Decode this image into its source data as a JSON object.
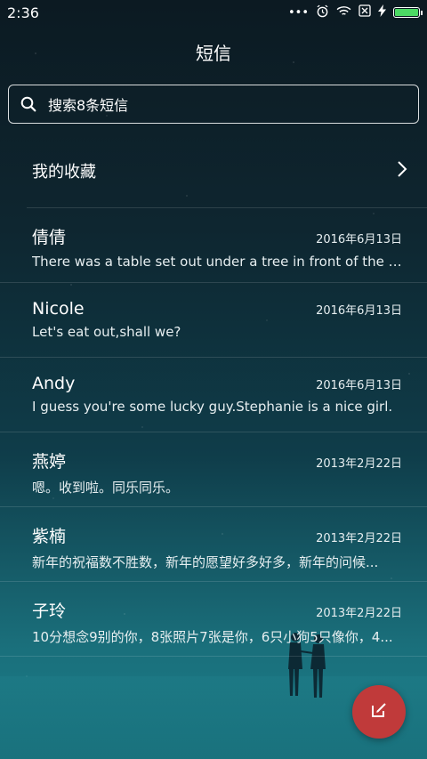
{
  "status_bar": {
    "time": "2:36",
    "signal": "•••",
    "alarm_icon": "alarm-icon",
    "wifi_icon": "wifi-icon",
    "sim_icon": "no-sim-icon",
    "charging_icon": "bolt-icon",
    "battery_level": 1.0,
    "battery_color": "#4cd964"
  },
  "header": {
    "title": "短信"
  },
  "search": {
    "placeholder": "搜索8条短信"
  },
  "favorites": {
    "label": "我的收藏"
  },
  "threads": [
    {
      "name": "倩倩",
      "date": "2016年6月13日",
      "snippet": "There was a table set out under a tree in front of the ho..."
    },
    {
      "name": "Nicole",
      "date": "2016年6月13日",
      "snippet": "Let's eat out,shall we?"
    },
    {
      "name": "Andy",
      "date": "2016年6月13日",
      "snippet": "I guess you're some lucky guy.Stephanie is a nice girl."
    },
    {
      "name": "燕婷",
      "date": "2013年2月22日",
      "snippet": "嗯。收到啦。同乐同乐。"
    },
    {
      "name": "紫楠",
      "date": "2013年2月22日",
      "snippet": "新年的祝福数不胜数，新年的愿望好多好多，新年的问候..."
    },
    {
      "name": "子玲",
      "date": "2013年2月22日",
      "snippet": "10分想念9别的你，8张照片7张是你，6只小狗5只像你，4..."
    }
  ],
  "fab": {
    "icon": "compose-icon",
    "color": "#c03a3a"
  }
}
